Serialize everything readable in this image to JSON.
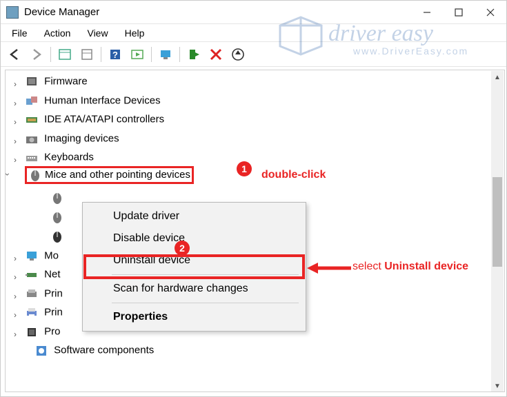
{
  "title": "Device Manager",
  "menubar": [
    "File",
    "Action",
    "View",
    "Help"
  ],
  "toolbar": {
    "back": "back-icon",
    "forward": "forward-icon",
    "show_hidden": "show-hidden-icon",
    "properties": "properties-icon",
    "help": "help-icon",
    "scan": "scan-icon",
    "display": "display-icon",
    "enable": "enable-device-icon",
    "uninstall": "uninstall-x-icon",
    "update": "update-circle-icon"
  },
  "tree": [
    {
      "label": "Firmware",
      "icon": "chip"
    },
    {
      "label": "Human Interface Devices",
      "icon": "hid"
    },
    {
      "label": "IDE ATA/ATAPI controllers",
      "icon": "ide"
    },
    {
      "label": "Imaging devices",
      "icon": "camera"
    },
    {
      "label": "Keyboards",
      "icon": "keyboard"
    },
    {
      "label": "Mice and other pointing devices",
      "icon": "mouse",
      "expanded": true,
      "children": 3
    },
    {
      "label": "Mo",
      "icon": "monitor",
      "truncated": true
    },
    {
      "label": "Net",
      "icon": "network",
      "truncated": true
    },
    {
      "label": "Prin",
      "icon": "prnport",
      "truncated": true
    },
    {
      "label": "Prin",
      "icon": "printer",
      "truncated": true
    },
    {
      "label": "Pro",
      "icon": "chip",
      "truncated": true
    },
    {
      "label": "Software components",
      "icon": "sw",
      "truncated": false,
      "expander": false
    }
  ],
  "context_menu": [
    {
      "label": "Update driver"
    },
    {
      "label": "Disable device"
    },
    {
      "label": "Uninstall device"
    },
    {
      "sep": true
    },
    {
      "label": "Scan for hardware changes"
    },
    {
      "sep": true
    },
    {
      "label": "Properties",
      "bold": true
    }
  ],
  "annotations": {
    "badge1": "1",
    "hint1": "double-click",
    "badge2": "2",
    "hint2_a": "select ",
    "hint2_b": "Uninstall device"
  },
  "watermark": {
    "brand": "driver easy",
    "sub": "www.DriverEasy.com"
  }
}
